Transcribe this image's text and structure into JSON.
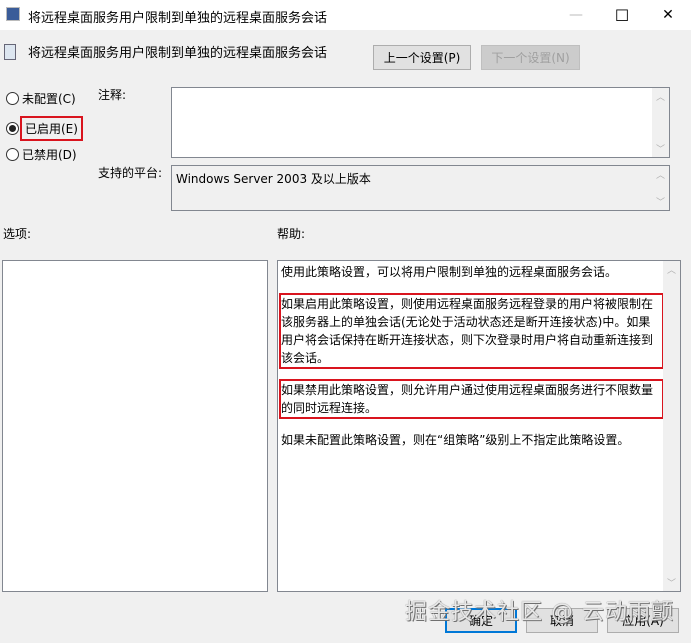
{
  "window": {
    "title": "将远程桌面服务用户限制到单独的远程桌面服务会话",
    "minimize": "—",
    "maximize": "☐",
    "close": "✕"
  },
  "header": {
    "title": "将远程桌面服务用户限制到单独的远程桌面服务会话",
    "prev_button": "上一个设置(P)",
    "next_button": "下一个设置(N)"
  },
  "state": {
    "options": [
      {
        "label": "未配置(C)",
        "checked": false
      },
      {
        "label": "已启用(E)",
        "checked": true
      },
      {
        "label": "已禁用(D)",
        "checked": false
      }
    ]
  },
  "comment": {
    "label": "注释:",
    "value": ""
  },
  "platform": {
    "label": "支持的平台:",
    "value": "Windows Server 2003 及以上版本"
  },
  "options_label": "选项:",
  "help": {
    "label": "帮助:",
    "paragraphs": [
      "使用此策略设置，可以将用户限制到单独的远程桌面服务会话。",
      "如果启用此策略设置，则使用远程桌面服务远程登录的用户将被限制在该服务器上的单独会话(无论处于活动状态还是断开连接状态)中。如果用户将会话保持在断开连接状态，则下次登录时用户将自动重新连接到该会话。",
      "如果禁用此策略设置，则允许用户通过使用远程桌面服务进行不限数量的同时远程连接。",
      "如果未配置此策略设置，则在“组策略”级别上不指定此策略设置。"
    ]
  },
  "footer": {
    "ok": "确定",
    "cancel": "取消",
    "apply": "应用(A)"
  },
  "watermark": "掘金技术社区 @ 云动雨颤",
  "colors": {
    "highlight": "#d9141e",
    "default_button_border": "#0078d7"
  }
}
